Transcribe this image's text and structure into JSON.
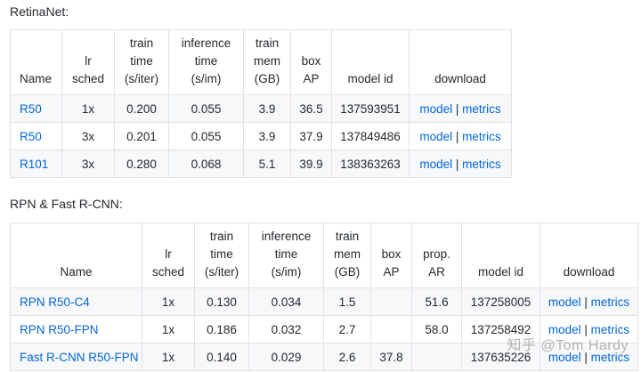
{
  "retinanet": {
    "title": "RetinaNet:",
    "headers": [
      [
        "Name"
      ],
      [
        "lr",
        "sched"
      ],
      [
        "train",
        "time",
        "(s/iter)"
      ],
      [
        "inference",
        "time",
        "(s/im)"
      ],
      [
        "train",
        "mem",
        "(GB)"
      ],
      [
        "box",
        "AP"
      ],
      [
        "model id"
      ],
      [
        "download"
      ]
    ],
    "rows": [
      {
        "name": "R50",
        "sched": "1x",
        "train_time": "0.200",
        "inference_time": "0.055",
        "mem": "3.9",
        "box_ap": "36.5",
        "model_id": "137593951",
        "model": "model",
        "metrics": "metrics"
      },
      {
        "name": "R50",
        "sched": "3x",
        "train_time": "0.201",
        "inference_time": "0.055",
        "mem": "3.9",
        "box_ap": "37.9",
        "model_id": "137849486",
        "model": "model",
        "metrics": "metrics"
      },
      {
        "name": "R101",
        "sched": "3x",
        "train_time": "0.280",
        "inference_time": "0.068",
        "mem": "5.1",
        "box_ap": "39.9",
        "model_id": "138363263",
        "model": "model",
        "metrics": "metrics"
      }
    ]
  },
  "rpn": {
    "title": "RPN & Fast R-CNN:",
    "headers": [
      [
        "Name"
      ],
      [
        "lr",
        "sched"
      ],
      [
        "train",
        "time",
        "(s/iter)"
      ],
      [
        "inference",
        "time",
        "(s/im)"
      ],
      [
        "train",
        "mem",
        "(GB)"
      ],
      [
        "box",
        "AP"
      ],
      [
        "prop.",
        "AR"
      ],
      [
        "model id"
      ],
      [
        "download"
      ]
    ],
    "rows": [
      {
        "name": "RPN R50-C4",
        "sched": "1x",
        "train_time": "0.130",
        "inference_time": "0.034",
        "mem": "1.5",
        "box_ap": "",
        "prop_ar": "51.6",
        "model_id": "137258005",
        "model": "model",
        "metrics": "metrics"
      },
      {
        "name": "RPN R50-FPN",
        "sched": "1x",
        "train_time": "0.186",
        "inference_time": "0.032",
        "mem": "2.7",
        "box_ap": "",
        "prop_ar": "58.0",
        "model_id": "137258492",
        "model": "model",
        "metrics": "metrics"
      },
      {
        "name": "Fast R-CNN R50-FPN",
        "sched": "1x",
        "train_time": "0.140",
        "inference_time": "0.029",
        "mem": "2.6",
        "box_ap": "37.8",
        "prop_ar": "",
        "model_id": "137635226",
        "model": "model",
        "metrics": "metrics"
      }
    ]
  },
  "watermark": "知乎 @Tom Hardy",
  "colors": {
    "link": "#0366d6",
    "stripe": "#f6f8fa",
    "border": "#dfe2e5"
  }
}
